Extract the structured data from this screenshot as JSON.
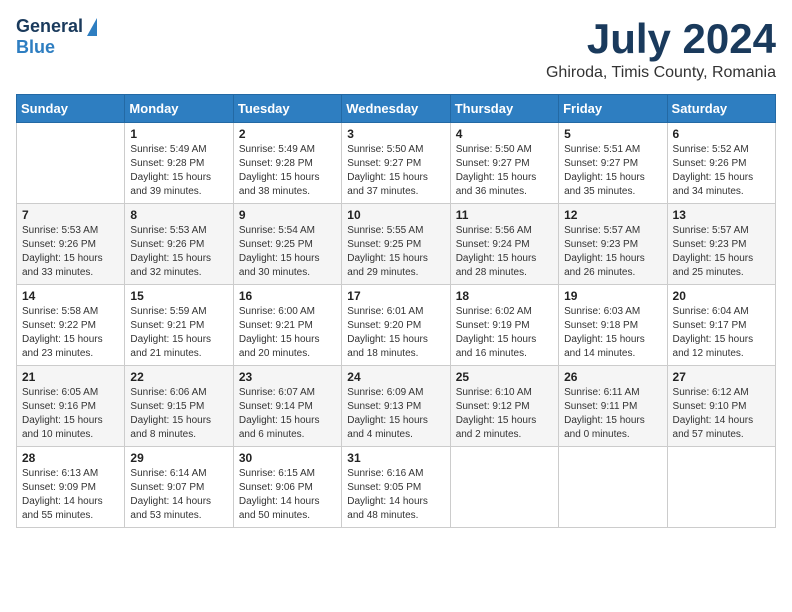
{
  "header": {
    "logo": {
      "general": "General",
      "blue": "Blue"
    },
    "title": "July 2024",
    "location": "Ghiroda, Timis County, Romania"
  },
  "calendar": {
    "days": [
      "Sunday",
      "Monday",
      "Tuesday",
      "Wednesday",
      "Thursday",
      "Friday",
      "Saturday"
    ],
    "weeks": [
      [
        {
          "day": "",
          "sunrise": "",
          "sunset": "",
          "daylight": ""
        },
        {
          "day": "1",
          "sunrise": "Sunrise: 5:49 AM",
          "sunset": "Sunset: 9:28 PM",
          "daylight": "Daylight: 15 hours and 39 minutes."
        },
        {
          "day": "2",
          "sunrise": "Sunrise: 5:49 AM",
          "sunset": "Sunset: 9:28 PM",
          "daylight": "Daylight: 15 hours and 38 minutes."
        },
        {
          "day": "3",
          "sunrise": "Sunrise: 5:50 AM",
          "sunset": "Sunset: 9:27 PM",
          "daylight": "Daylight: 15 hours and 37 minutes."
        },
        {
          "day": "4",
          "sunrise": "Sunrise: 5:50 AM",
          "sunset": "Sunset: 9:27 PM",
          "daylight": "Daylight: 15 hours and 36 minutes."
        },
        {
          "day": "5",
          "sunrise": "Sunrise: 5:51 AM",
          "sunset": "Sunset: 9:27 PM",
          "daylight": "Daylight: 15 hours and 35 minutes."
        },
        {
          "day": "6",
          "sunrise": "Sunrise: 5:52 AM",
          "sunset": "Sunset: 9:26 PM",
          "daylight": "Daylight: 15 hours and 34 minutes."
        }
      ],
      [
        {
          "day": "7",
          "sunrise": "Sunrise: 5:53 AM",
          "sunset": "Sunset: 9:26 PM",
          "daylight": "Daylight: 15 hours and 33 minutes."
        },
        {
          "day": "8",
          "sunrise": "Sunrise: 5:53 AM",
          "sunset": "Sunset: 9:26 PM",
          "daylight": "Daylight: 15 hours and 32 minutes."
        },
        {
          "day": "9",
          "sunrise": "Sunrise: 5:54 AM",
          "sunset": "Sunset: 9:25 PM",
          "daylight": "Daylight: 15 hours and 30 minutes."
        },
        {
          "day": "10",
          "sunrise": "Sunrise: 5:55 AM",
          "sunset": "Sunset: 9:25 PM",
          "daylight": "Daylight: 15 hours and 29 minutes."
        },
        {
          "day": "11",
          "sunrise": "Sunrise: 5:56 AM",
          "sunset": "Sunset: 9:24 PM",
          "daylight": "Daylight: 15 hours and 28 minutes."
        },
        {
          "day": "12",
          "sunrise": "Sunrise: 5:57 AM",
          "sunset": "Sunset: 9:23 PM",
          "daylight": "Daylight: 15 hours and 26 minutes."
        },
        {
          "day": "13",
          "sunrise": "Sunrise: 5:57 AM",
          "sunset": "Sunset: 9:23 PM",
          "daylight": "Daylight: 15 hours and 25 minutes."
        }
      ],
      [
        {
          "day": "14",
          "sunrise": "Sunrise: 5:58 AM",
          "sunset": "Sunset: 9:22 PM",
          "daylight": "Daylight: 15 hours and 23 minutes."
        },
        {
          "day": "15",
          "sunrise": "Sunrise: 5:59 AM",
          "sunset": "Sunset: 9:21 PM",
          "daylight": "Daylight: 15 hours and 21 minutes."
        },
        {
          "day": "16",
          "sunrise": "Sunrise: 6:00 AM",
          "sunset": "Sunset: 9:21 PM",
          "daylight": "Daylight: 15 hours and 20 minutes."
        },
        {
          "day": "17",
          "sunrise": "Sunrise: 6:01 AM",
          "sunset": "Sunset: 9:20 PM",
          "daylight": "Daylight: 15 hours and 18 minutes."
        },
        {
          "day": "18",
          "sunrise": "Sunrise: 6:02 AM",
          "sunset": "Sunset: 9:19 PM",
          "daylight": "Daylight: 15 hours and 16 minutes."
        },
        {
          "day": "19",
          "sunrise": "Sunrise: 6:03 AM",
          "sunset": "Sunset: 9:18 PM",
          "daylight": "Daylight: 15 hours and 14 minutes."
        },
        {
          "day": "20",
          "sunrise": "Sunrise: 6:04 AM",
          "sunset": "Sunset: 9:17 PM",
          "daylight": "Daylight: 15 hours and 12 minutes."
        }
      ],
      [
        {
          "day": "21",
          "sunrise": "Sunrise: 6:05 AM",
          "sunset": "Sunset: 9:16 PM",
          "daylight": "Daylight: 15 hours and 10 minutes."
        },
        {
          "day": "22",
          "sunrise": "Sunrise: 6:06 AM",
          "sunset": "Sunset: 9:15 PM",
          "daylight": "Daylight: 15 hours and 8 minutes."
        },
        {
          "day": "23",
          "sunrise": "Sunrise: 6:07 AM",
          "sunset": "Sunset: 9:14 PM",
          "daylight": "Daylight: 15 hours and 6 minutes."
        },
        {
          "day": "24",
          "sunrise": "Sunrise: 6:09 AM",
          "sunset": "Sunset: 9:13 PM",
          "daylight": "Daylight: 15 hours and 4 minutes."
        },
        {
          "day": "25",
          "sunrise": "Sunrise: 6:10 AM",
          "sunset": "Sunset: 9:12 PM",
          "daylight": "Daylight: 15 hours and 2 minutes."
        },
        {
          "day": "26",
          "sunrise": "Sunrise: 6:11 AM",
          "sunset": "Sunset: 9:11 PM",
          "daylight": "Daylight: 15 hours and 0 minutes."
        },
        {
          "day": "27",
          "sunrise": "Sunrise: 6:12 AM",
          "sunset": "Sunset: 9:10 PM",
          "daylight": "Daylight: 14 hours and 57 minutes."
        }
      ],
      [
        {
          "day": "28",
          "sunrise": "Sunrise: 6:13 AM",
          "sunset": "Sunset: 9:09 PM",
          "daylight": "Daylight: 14 hours and 55 minutes."
        },
        {
          "day": "29",
          "sunrise": "Sunrise: 6:14 AM",
          "sunset": "Sunset: 9:07 PM",
          "daylight": "Daylight: 14 hours and 53 minutes."
        },
        {
          "day": "30",
          "sunrise": "Sunrise: 6:15 AM",
          "sunset": "Sunset: 9:06 PM",
          "daylight": "Daylight: 14 hours and 50 minutes."
        },
        {
          "day": "31",
          "sunrise": "Sunrise: 6:16 AM",
          "sunset": "Sunset: 9:05 PM",
          "daylight": "Daylight: 14 hours and 48 minutes."
        },
        {
          "day": "",
          "sunrise": "",
          "sunset": "",
          "daylight": ""
        },
        {
          "day": "",
          "sunrise": "",
          "sunset": "",
          "daylight": ""
        },
        {
          "day": "",
          "sunrise": "",
          "sunset": "",
          "daylight": ""
        }
      ]
    ]
  }
}
